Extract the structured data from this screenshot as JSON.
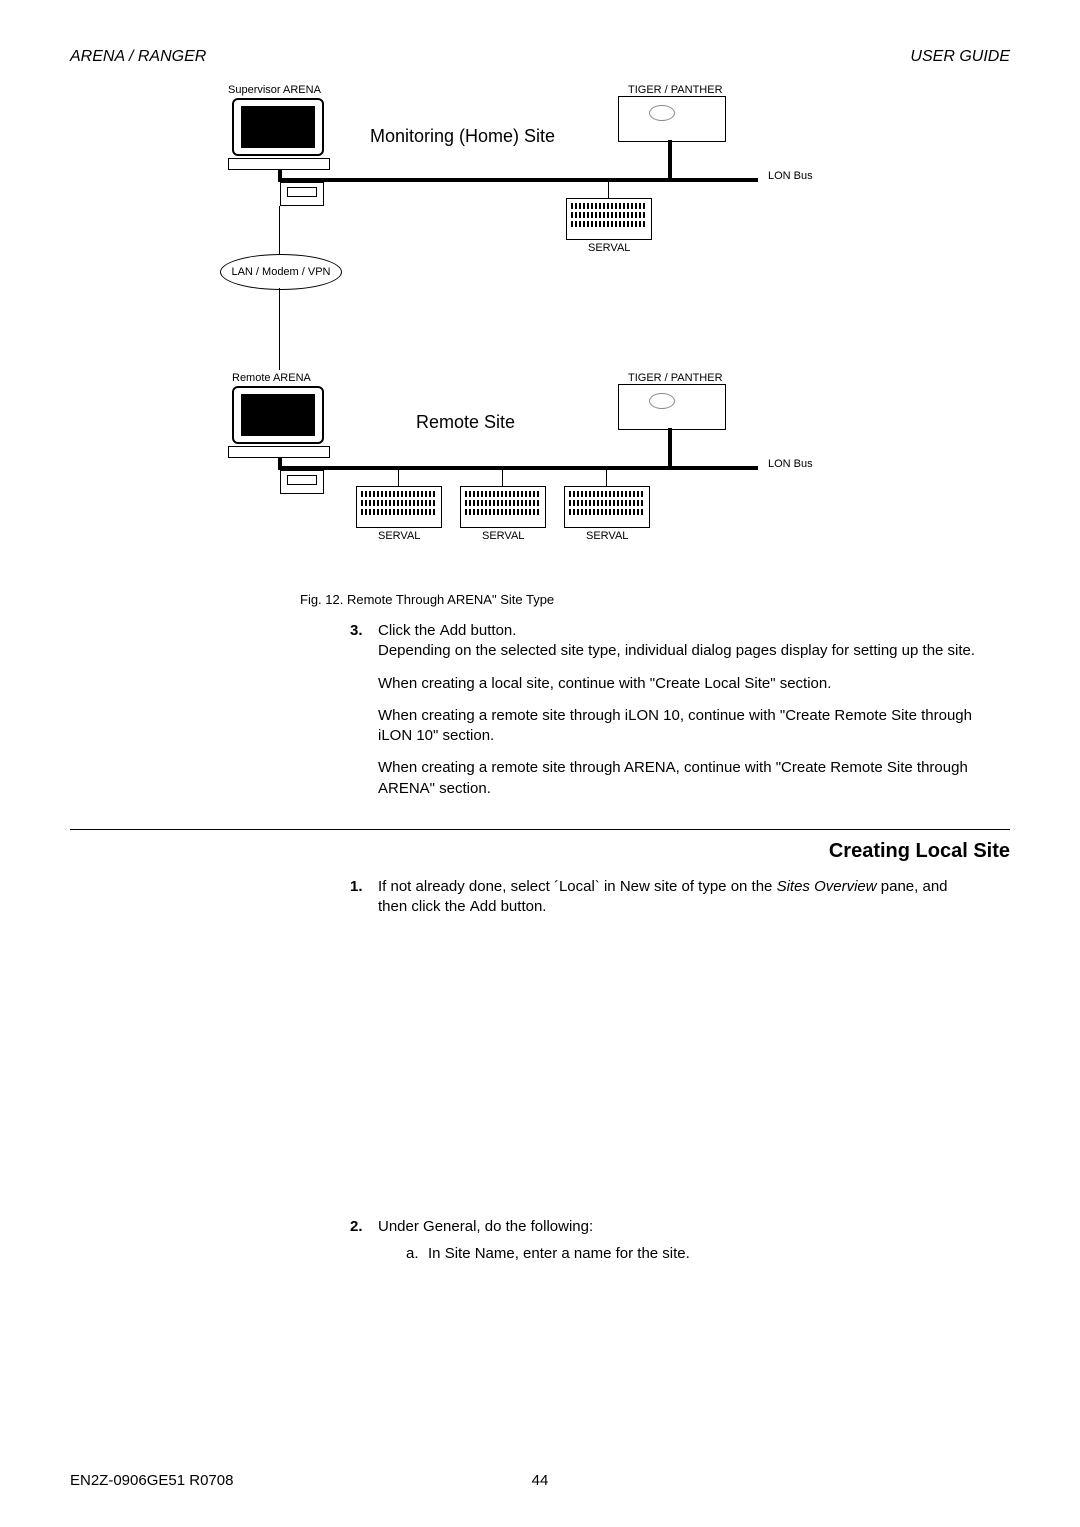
{
  "header": {
    "left": "ARENA / RANGER",
    "right": "USER GUIDE"
  },
  "diagram": {
    "supervisor_label": "Supervisor ARENA",
    "monitoring_title": "Monitoring (Home) Site",
    "tiger_panther": "TIGER / PANTHER",
    "lon_bus": "LON Bus",
    "serval": "SERVAL",
    "lan_label": "LAN / Modem / VPN",
    "remote_arena_label": "Remote ARENA",
    "remote_title": "Remote Site",
    "caption": "Fig. 12.  Remote Through ARENA\" Site Type"
  },
  "step3": {
    "num": "3.",
    "line1a": "Click the ",
    "line1_add": "Add",
    "line1b": " button.",
    "line2": "Depending on the selected site type, individual dialog pages display for setting up the site.",
    "para1": "When creating a local site, continue with \"Create Local Site\" section.",
    "para2": "When creating a remote site through iLON 10, continue with \"Create Remote Site through iLON 10\" section.",
    "para3": "When creating a remote site through ARENA, continue with \"Create Remote Site through ARENA\" section."
  },
  "h2": "Creating Local Site",
  "step1": {
    "num": "1.",
    "a": "If not already done, select ´Local` in ",
    "new_site": "New site of type",
    "b": " on the ",
    "sites_overview": "Sites Overview",
    "c": " pane, and then click the ",
    "add": "Add",
    "d": " button."
  },
  "step2": {
    "num": "2.",
    "a": "Under ",
    "general": "General",
    "b": ", do the following:",
    "sub_a_let": "a.",
    "sub_a_1": "In ",
    "sub_a_sn": "Site Name",
    "sub_a_2": ", enter a name for the site."
  },
  "footer": {
    "left": "EN2Z-0906GE51 R0708",
    "center": "44"
  }
}
